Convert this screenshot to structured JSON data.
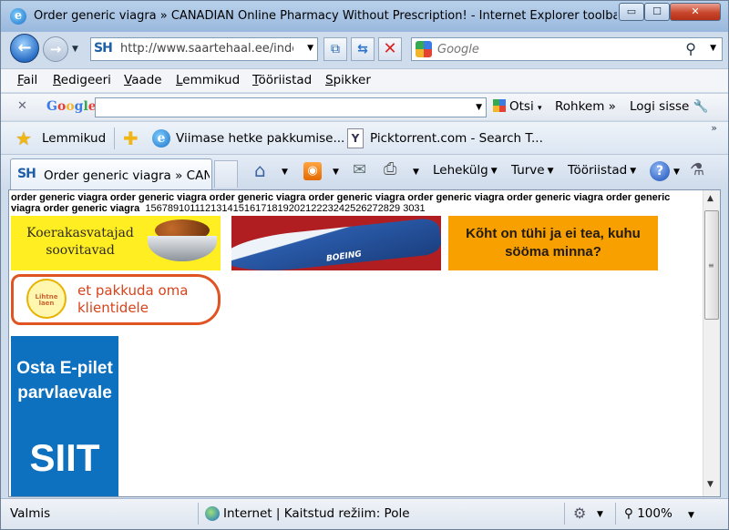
{
  "window": {
    "title": "Order generic viagra » CANADIAN Online Pharmacy Without Prescription! - Internet Explorer toolbar",
    "min_glyph": "▭",
    "max_glyph": "☐",
    "close_glyph": "✕"
  },
  "address_bar": {
    "site_icon": "SH",
    "url": "http://www.saartehaal.ee/index.php",
    "search_placeholder": "Google"
  },
  "menu": [
    "Fail",
    "Redigeeri",
    "Vaade",
    "Lemmikud",
    "Tööriistad",
    "Spikker"
  ],
  "google_toolbar": {
    "logo": "Google",
    "search_label": "Otsi",
    "more_label": "Rohkem",
    "login_label": "Logi sisse"
  },
  "favorites": {
    "label": "Lemmikud",
    "links": [
      "Viimase hetke pakkumise...",
      "Picktorrent.com - Search T..."
    ]
  },
  "tab": {
    "icon": "SH",
    "label": "Order generic viagra » CANADIAN"
  },
  "commands": {
    "page": "Lehekülg",
    "safety": "Turve",
    "tools": "Tööriistad",
    "help": "?"
  },
  "page": {
    "heading": "order generic viagra order generic viagra order generic viagra order generic viagra order generic viagra order generic viagra order generic viagra order generic viagra",
    "numbers": "1567891011121314151617181920212223242526272829 3031",
    "ads": {
      "dog_food": "Koerakasvatajad soovitavad",
      "plane_brand": "BOEING",
      "food": "Kõht on tühi ja ei tea, kuhu sööma minna?",
      "loan_logo": "Lihtne laen",
      "loan": "et pakkuda oma klientidele",
      "ferry": "Osta E-pilet parvlaevale",
      "ferry_cta": "SIIT"
    }
  },
  "statusbar": {
    "status": "Valmis",
    "zone": "Internet | Kaitstud režiim: Pole",
    "zoom": "100%"
  }
}
